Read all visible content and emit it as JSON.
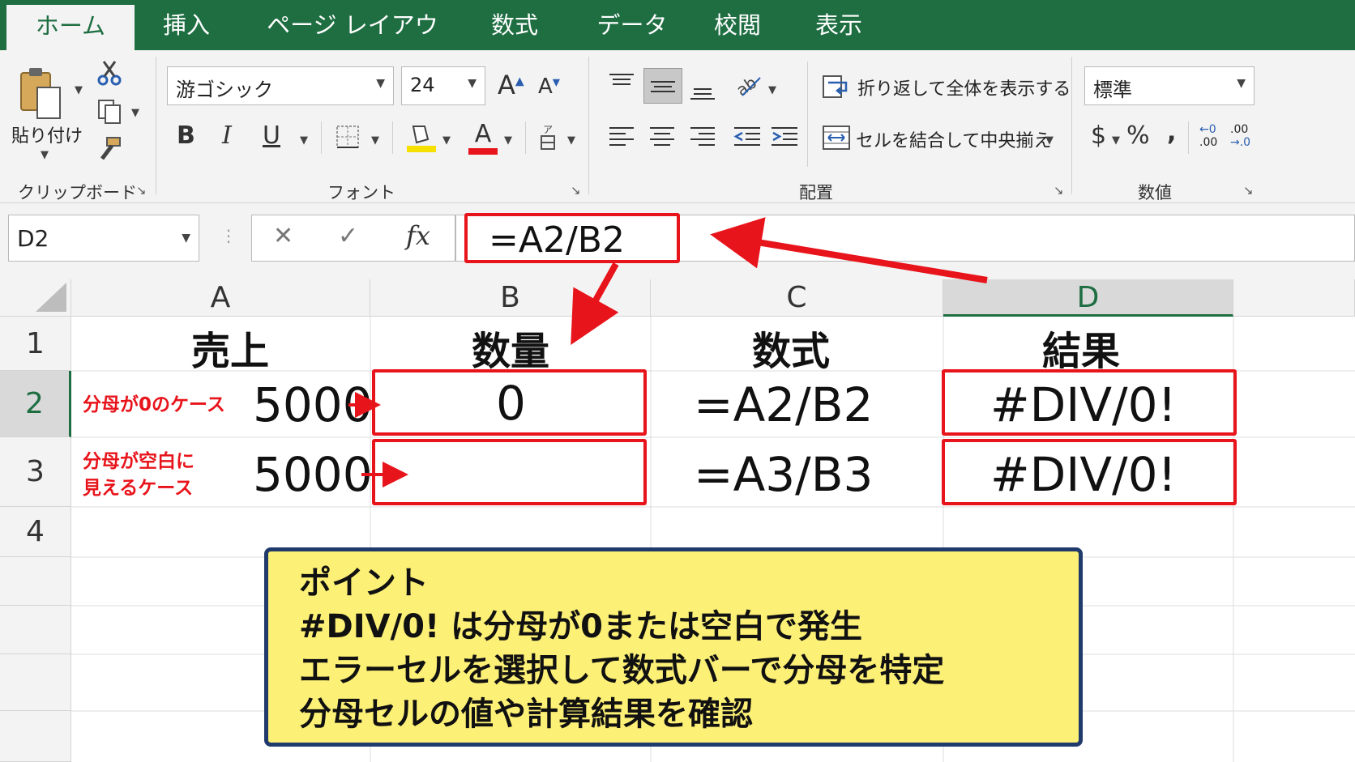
{
  "ribbon": {
    "tabs": [
      "ホーム",
      "挿入",
      "ページ レイアウト",
      "数式",
      "データ",
      "校閲",
      "表示"
    ],
    "active_tab": "ホーム",
    "clipboard": {
      "paste_label": "貼り付け",
      "group_label": "クリップボード"
    },
    "font": {
      "name": "游ゴシック",
      "size": "24",
      "group_label": "フォント",
      "grow": "A",
      "shrink": "A",
      "bold": "B",
      "italic": "I",
      "underline": "U",
      "font_color_letter": "A"
    },
    "alignment": {
      "wrap_text": "折り返して全体を表示する",
      "merge_center": "セルを結合して中央揃え",
      "group_label": "配置"
    },
    "number": {
      "format": "標準",
      "currency": "$",
      "percent": "%",
      "comma": ",",
      "group_label": "数値",
      "inc_top": "←0",
      "inc_bottom": ".00",
      "dec_top": ".00",
      "dec_bottom": "→.0"
    }
  },
  "formula_bar": {
    "name_box": "D2",
    "cancel": "✕",
    "enter": "✓",
    "fx": "fx",
    "formula": "=A2/B2"
  },
  "columns": [
    "A",
    "B",
    "C",
    "D"
  ],
  "rows": [
    "1",
    "2",
    "3",
    "4"
  ],
  "cells": {
    "A1": "売上",
    "B1": "数量",
    "C1": "数式",
    "D1": "結果",
    "A2": "5000",
    "B2": "0",
    "C2": "=A2/B2",
    "D2": "#DIV/0!",
    "A3": "5000",
    "B3": "",
    "C3": "=A3/B3",
    "D3": "#DIV/0!"
  },
  "annotations": {
    "row2_note": "分母が0のケース",
    "row3_note_line1": "分母が空白に",
    "row3_note_line2": "見えるケース"
  },
  "callout": {
    "title": "ポイント",
    "lines": [
      "#DIV/0! は分母が0または空白で発生",
      "エラーセルを選択して数式バーで分母を特定",
      "分母セルの値や計算結果を確認"
    ]
  },
  "colors": {
    "excel_green": "#1e6e42",
    "highlight_red": "#e8141b",
    "callout_fill": "#fdf076",
    "callout_border": "#1f3a6b"
  }
}
